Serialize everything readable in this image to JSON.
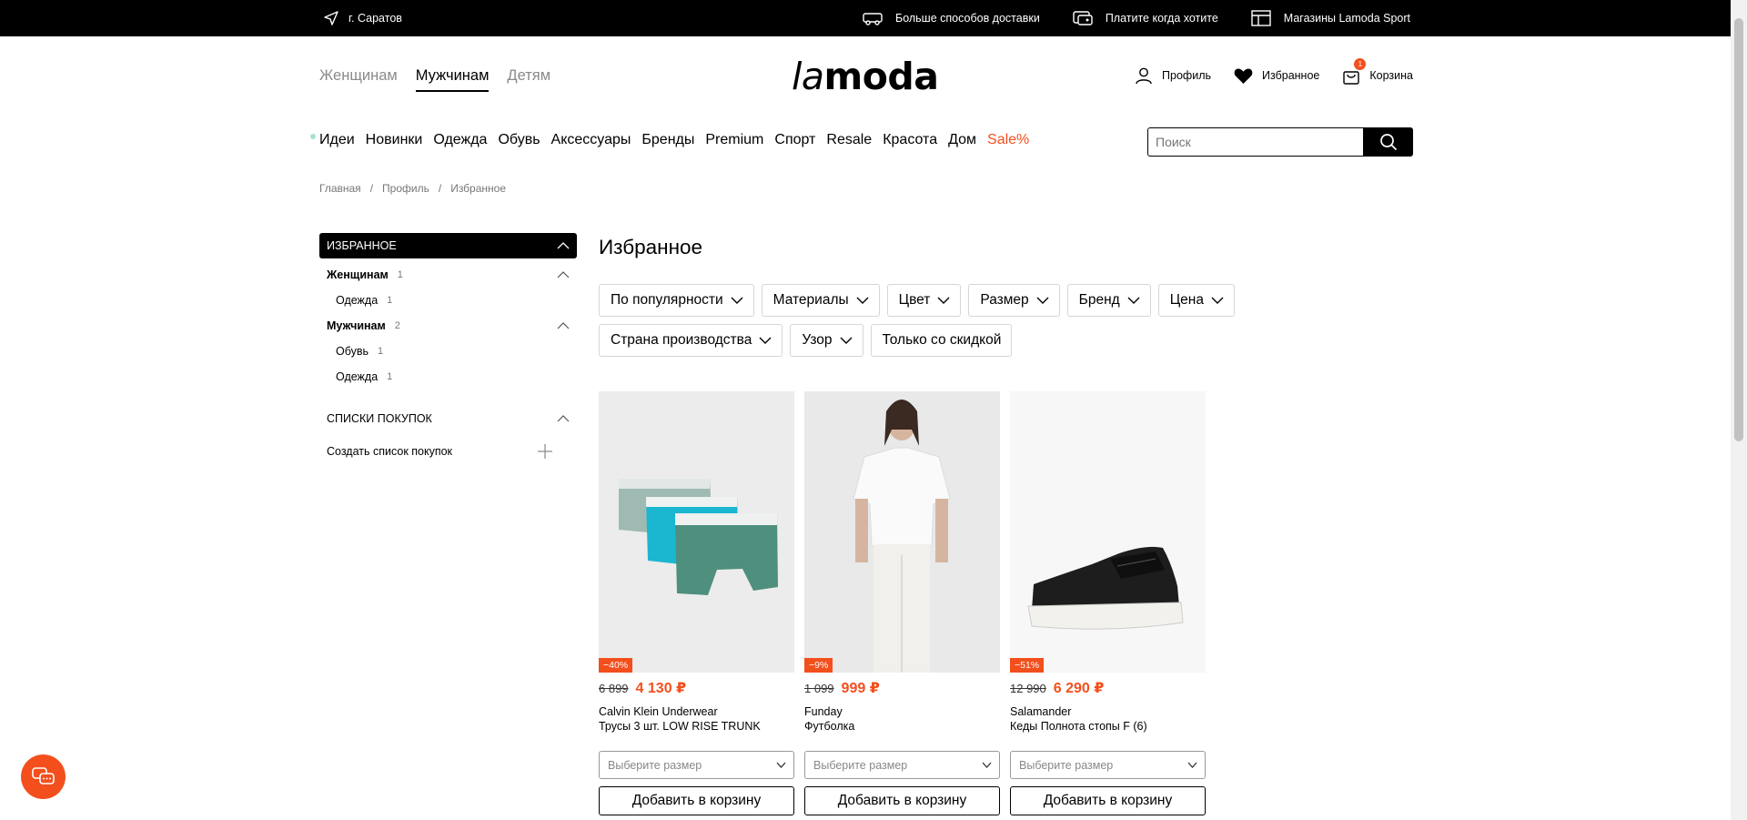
{
  "topbar": {
    "city": "г. Саратов",
    "links": [
      {
        "label": "Больше способов доставки",
        "icon": "truck-icon"
      },
      {
        "label": "Платите когда хотите",
        "icon": "wallet-icon"
      },
      {
        "label": "Магазины Lamoda Sport",
        "icon": "store-icon"
      }
    ]
  },
  "header": {
    "genders": [
      "Женщинам",
      "Мужчинам",
      "Детям"
    ],
    "active_gender": "Мужчинам",
    "logo_la": "la",
    "logo_moda": "moda",
    "profile": "Профиль",
    "favorites": "Избранное",
    "cart": "Корзина",
    "cart_count": "1"
  },
  "catnav": [
    "Идеи",
    "Новинки",
    "Одежда",
    "Обувь",
    "Аксессуары",
    "Бренды",
    "Premium",
    "Спорт",
    "Resale",
    "Красота",
    "Дом",
    "Sale%"
  ],
  "search": {
    "placeholder": "Поиск"
  },
  "breadcrumbs": [
    "Главная",
    "Профиль",
    "Избранное"
  ],
  "sidebar": {
    "favorites_title": "ИЗБРАННОЕ",
    "groups": [
      {
        "label": "Женщинам",
        "count": "1",
        "children": [
          {
            "label": "Одежда",
            "count": "1"
          }
        ]
      },
      {
        "label": "Мужчинам",
        "count": "2",
        "children": [
          {
            "label": "Обувь",
            "count": "1"
          },
          {
            "label": "Одежда",
            "count": "1"
          }
        ]
      }
    ],
    "lists_title": "СПИСКИ ПОКУПОК",
    "create_list": "Создать список покупок"
  },
  "main": {
    "title": "Избранное",
    "filters": [
      "По популярности",
      "Материалы",
      "Цвет",
      "Размер",
      "Бренд",
      "Цена",
      "Страна производства",
      "Узор"
    ],
    "discount_filter": "Только со скидкой"
  },
  "products": [
    {
      "discount": "−40%",
      "old_price": "6 899",
      "price": "4 130 ₽",
      "brand": "Calvin Klein Underwear",
      "name": "Трусы 3 шт. LOW RISE TRUNK",
      "size_placeholder": "Выберите размер",
      "add_label": "Добавить в корзину"
    },
    {
      "discount": "−9%",
      "old_price": "1 099",
      "price": "999 ₽",
      "brand": "Funday",
      "name": "Футболка",
      "size_placeholder": "Выберите размер",
      "add_label": "Добавить в корзину"
    },
    {
      "discount": "−51%",
      "old_price": "12 990",
      "price": "6 290 ₽",
      "brand": "Salamander",
      "name": "Кеды Полнота стопы F (6)",
      "size_placeholder": "Выберите размер",
      "add_label": "Добавить в корзину"
    }
  ],
  "colors": {
    "accent": "#f34f1d",
    "black": "#000000"
  }
}
